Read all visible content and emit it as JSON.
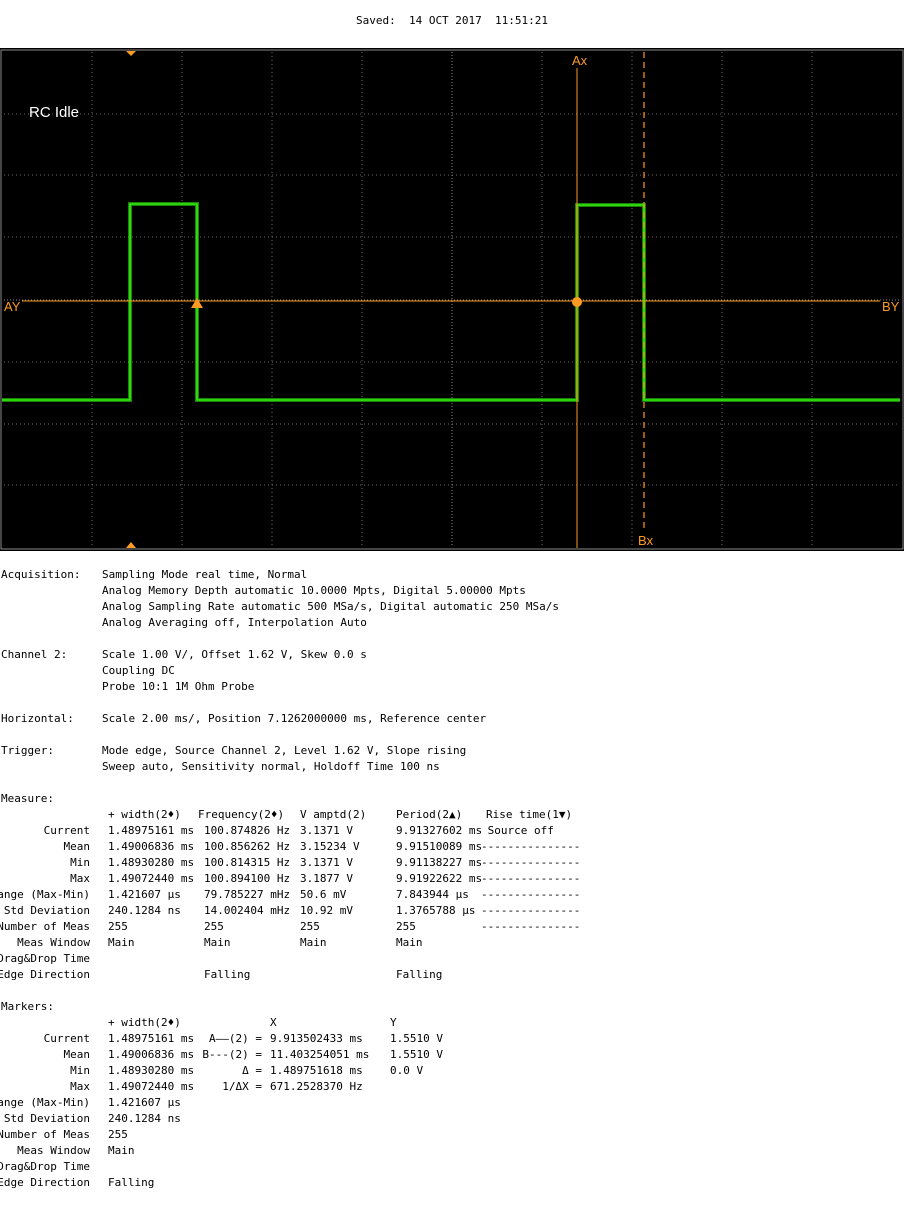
{
  "header": {
    "saved": "Saved:  14 OCT 2017  11:51:21"
  },
  "screen": {
    "label": "RC Idle",
    "markers": {
      "ax": "Ax",
      "bx": "Bx",
      "ay": "AY",
      "by": "BY"
    },
    "colors": {
      "background": "#000000",
      "trace": "#33ee11",
      "marker": "#ff9a22",
      "grid": "#777777"
    }
  },
  "info": {
    "acquisition": {
      "label": "Acquisition:",
      "lines": [
        "Sampling Mode real time, Normal",
        "Analog Memory Depth automatic 10.0000 Mpts, Digital 5.00000 Mpts",
        "Analog Sampling Rate automatic 500 MSa/s, Digital automatic 250 MSa/s",
        "Analog Averaging off, Interpolation Auto"
      ]
    },
    "channel2": {
      "label": "Channel 2:",
      "lines": [
        "Scale 1.00 V/, Offset 1.62 V, Skew 0.0 s",
        "Coupling DC",
        "Probe 10:1 1M Ohm Probe"
      ]
    },
    "horizontal": {
      "label": "Horizontal:",
      "lines": [
        "Scale 2.00 ms/, Position 7.1262000000 ms, Reference center"
      ]
    },
    "trigger": {
      "label": "Trigger:",
      "lines": [
        "Mode edge, Source Channel 2, Level 1.62 V, Slope rising",
        "Sweep auto, Sensitivity normal, Holdoff Time 100 ns"
      ]
    }
  },
  "measure": {
    "title": "Measure:",
    "headers": [
      "+ width(2♦)",
      "Frequency(2♦)",
      "V amptd(2)",
      "Period(2▲)",
      "Rise time(1▼)"
    ],
    "rows": [
      {
        "label": "Current",
        "cells": [
          "1.48975161 ms",
          "100.874826 Hz",
          "3.1371 V",
          "9.91327602 ms",
          " Source off"
        ]
      },
      {
        "label": "Mean",
        "cells": [
          "1.49006836 ms",
          "100.856262 Hz",
          "3.15234 V",
          "9.91510089 ms",
          "---------------"
        ]
      },
      {
        "label": "Min",
        "cells": [
          "1.48930280 ms",
          "100.814315 Hz",
          "3.1371 V",
          "9.91138227 ms",
          "---------------"
        ]
      },
      {
        "label": "Max",
        "cells": [
          "1.49072440 ms",
          "100.894100 Hz",
          "3.1877 V",
          "9.91922622 ms",
          "---------------"
        ]
      },
      {
        "label": "Range (Max-Min)",
        "cells": [
          "1.421607 µs",
          "79.785227 mHz",
          "50.6 mV",
          "7.843944 µs",
          "---------------"
        ]
      },
      {
        "label": "Std Deviation",
        "cells": [
          "240.1284 ns",
          "14.002404 mHz",
          "10.92 mV",
          "1.3765788 µs",
          "---------------"
        ]
      },
      {
        "label": "Number of Meas",
        "cells": [
          "255",
          "255",
          "255",
          "255",
          "---------------"
        ]
      },
      {
        "label": "Meas Window",
        "cells": [
          "Main",
          "Main",
          "Main",
          "Main",
          ""
        ]
      },
      {
        "label": "Drag&Drop Time",
        "cells": [
          "",
          "",
          "",
          "",
          ""
        ]
      },
      {
        "label": "Edge Direction",
        "cells": [
          "",
          "Falling",
          "",
          "Falling",
          ""
        ]
      }
    ]
  },
  "markers_table": {
    "title": "Markers:",
    "headers": [
      "+ width(2♦)",
      "X",
      "Y"
    ],
    "rows": [
      {
        "label": "Current",
        "width": "1.48975161 ms",
        "name": "A——(2) =",
        "x": "9.913502433 ms",
        "y": "1.5510 V"
      },
      {
        "label": "Mean",
        "width": "1.49006836 ms",
        "name": "B---(2) =",
        "x": "11.403254051 ms",
        "y": "1.5510 V"
      },
      {
        "label": "Min",
        "width": "1.48930280 ms",
        "name": "Δ =",
        "x": "1.489751618 ms",
        "y": "0.0 V"
      },
      {
        "label": "Max",
        "width": "1.49072440 ms",
        "name": "1/ΔX =",
        "x": "671.2528370 Hz",
        "y": ""
      },
      {
        "label": "Range (Max-Min)",
        "width": "1.421607 µs",
        "name": "",
        "x": "",
        "y": ""
      },
      {
        "label": "Std Deviation",
        "width": "240.1284 ns",
        "name": "",
        "x": "",
        "y": ""
      },
      {
        "label": "Number of Meas",
        "width": "255",
        "name": "",
        "x": "",
        "y": ""
      },
      {
        "label": "Meas Window",
        "width": "Main",
        "name": "",
        "x": "",
        "y": ""
      },
      {
        "label": "Drag&Drop Time",
        "width": "",
        "name": "",
        "x": "",
        "y": ""
      },
      {
        "label": "Edge Direction",
        "width": "Falling",
        "name": "",
        "x": "",
        "y": ""
      }
    ]
  }
}
